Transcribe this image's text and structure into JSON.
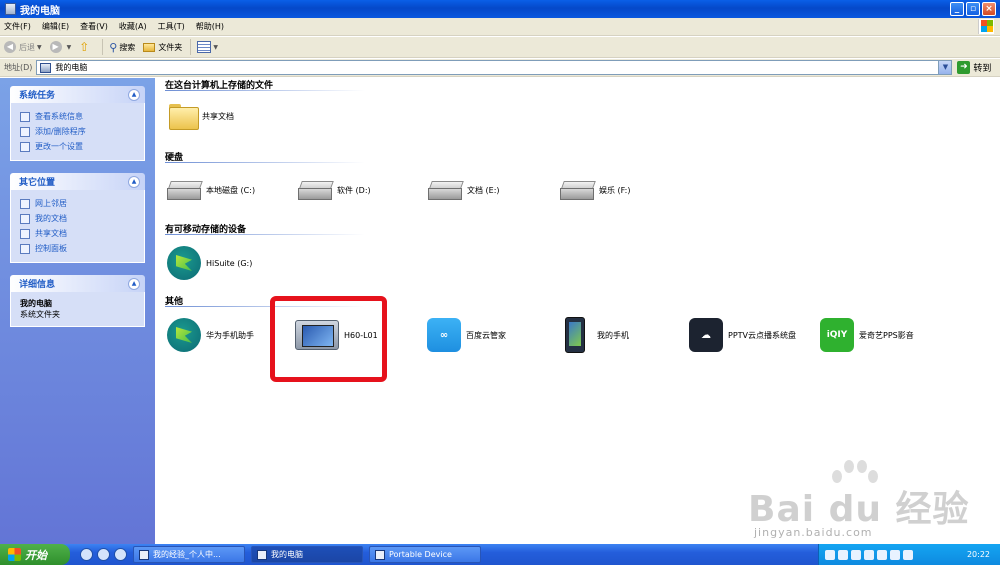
{
  "window": {
    "title": "我的电脑",
    "minimize": "_",
    "maximize": "▫",
    "close": "×"
  },
  "menu": [
    "文件(F)",
    "编辑(E)",
    "查看(V)",
    "收藏(A)",
    "工具(T)",
    "帮助(H)"
  ],
  "toolbar": {
    "back": "后退",
    "search": "搜索",
    "folders": "文件夹"
  },
  "address": {
    "label": "地址(D)",
    "value": "我的电脑",
    "go": "转到"
  },
  "left_panels": {
    "system_tasks": {
      "title": "系统任务",
      "links": [
        "查看系统信息",
        "添加/删除程序",
        "更改一个设置"
      ]
    },
    "other_places": {
      "title": "其它位置",
      "links": [
        "网上邻居",
        "我的文档",
        "共享文档",
        "控制面板"
      ]
    },
    "details": {
      "title": "详细信息",
      "name": "我的电脑",
      "type": "系统文件夹"
    }
  },
  "groups": {
    "stored_files": {
      "header": "在这台计算机上存储的文件",
      "items": [
        "共享文档"
      ]
    },
    "hard_drives": {
      "header": "硬盘",
      "items": [
        "本地磁盘 (C:)",
        "软件 (D:)",
        "文档 (E:)",
        "娱乐 (F:)"
      ]
    },
    "removable": {
      "header": "有可移动存储的设备",
      "items": [
        "HiSuite (G:)"
      ]
    },
    "other": {
      "header": "其他",
      "items": [
        "华为手机助手",
        "H60-L01",
        "百度云管家",
        "我的手机",
        "PPTV云点播系统盘",
        "爱奇艺PPS影音"
      ]
    }
  },
  "taskbar": {
    "start": "开始",
    "tasks": [
      "我的经验_个人中...",
      "我的电脑",
      "Portable Device"
    ],
    "clock": "20:22"
  },
  "watermark": {
    "text": "Bai du 经验",
    "url": "jingyan.baidu.com"
  },
  "colors": {
    "highlight": "#e6121c",
    "titlebar": "#0a5fe8",
    "task_pane": "#7ba2e7"
  }
}
